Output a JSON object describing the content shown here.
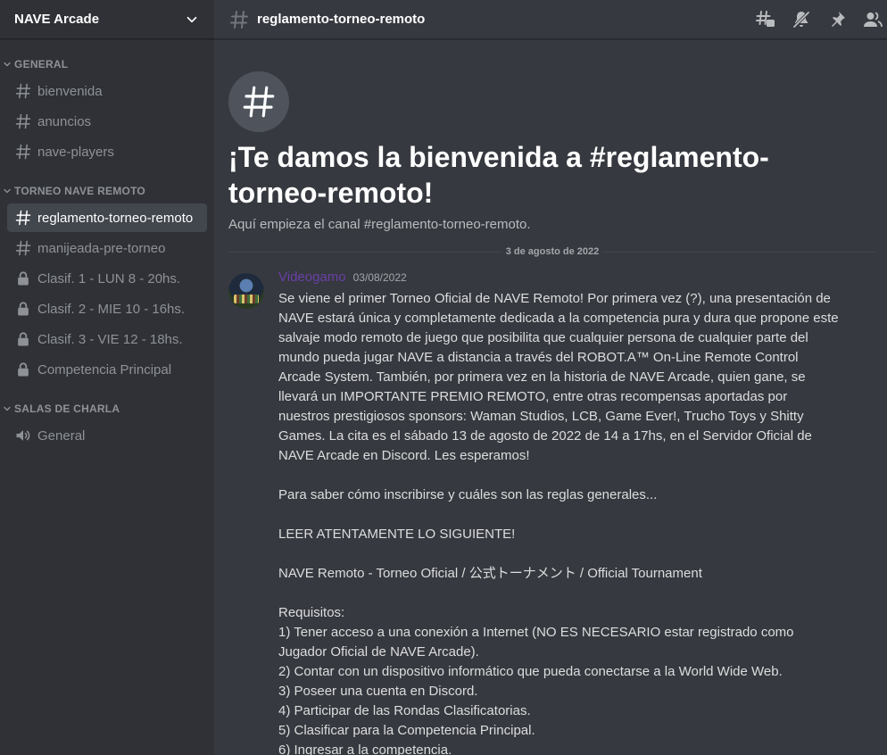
{
  "server": {
    "name": "NAVE Arcade"
  },
  "sidebar": {
    "categories": [
      {
        "label": "GENERAL",
        "channels": [
          {
            "label": "bienvenida",
            "icon": "hash-icon"
          },
          {
            "label": "anuncios",
            "icon": "hash-icon"
          },
          {
            "label": "nave-players",
            "icon": "hash-icon"
          }
        ]
      },
      {
        "label": "TORNEO NAVE REMOTO",
        "channels": [
          {
            "label": "reglamento-torneo-remoto",
            "icon": "hash-icon"
          },
          {
            "label": "manijeada-pre-torneo",
            "icon": "hash-icon"
          },
          {
            "label": "Clasif. 1 - LUN 8 - 20hs.",
            "icon": "lock-icon"
          },
          {
            "label": "Clasif. 2 - MIE 10 - 16hs.",
            "icon": "lock-icon"
          },
          {
            "label": "Clasif. 3 - VIE 12 - 18hs.",
            "icon": "lock-icon"
          },
          {
            "label": "Competencia Principal",
            "icon": "lock-icon"
          }
        ]
      },
      {
        "label": "SALAS DE CHARLA",
        "channels": [
          {
            "label": "General",
            "icon": "speaker-icon"
          }
        ]
      }
    ]
  },
  "header": {
    "channel_name": "reglamento-torneo-remoto",
    "tools": [
      "threads-icon",
      "mute-icon",
      "pin-icon",
      "members-icon"
    ]
  },
  "welcome": {
    "title": "¡Te damos la bienvenida a #reglamento-torneo-remoto!",
    "subtitle": "Aquí empieza el canal #reglamento-torneo-remoto."
  },
  "date_divider": "3 de agosto de 2022",
  "message": {
    "author": "Videogamo",
    "timestamp": "03/08/2022",
    "text": "Se viene el primer Torneo Oficial de NAVE Remoto! Por primera vez (?), una presentación de NAVE estará única y completamente dedicada a la competencia pura y dura que propone este salvaje modo remoto de juego que posibilita que cualquier persona de cualquier parte del mundo pueda jugar NAVE a distancia a través del ROBOT.A™ On-Line Remote Control Arcade System. También, por primera vez en la historia de NAVE Arcade, quien gane, se llevará un IMPORTANTE PREMIO REMOTO, entre otras recompensas aportadas por nuestros prestigiosos sponsors: Waman Studios, LCB, Game Ever!, Trucho Toys y Shitty Games. La cita es el sábado 13 de agosto de 2022 de 14 a 17hs, en el Servidor Oficial de NAVE Arcade en Discord. Les esperamos!\n\nPara saber cómo inscribirse y cuáles son las reglas generales...\n\nLEER ATENTAMENTE LO SIGUIENTE!\n\nNAVE Remoto - Torneo Oficial / 公式トーナメント / Official Tournament\n\nRequisitos:\n1) Tener acceso a una conexión a Internet (NO ES NECESARIO estar registrado como Jugador Oficial de NAVE Arcade).\n2) Contar con un dispositivo informático que pueda conectarse a la World Wide Web.\n3) Poseer una cuenta en Discord.\n4) Participar de las Rondas Clasificatorias.\n5) Clasificar para la Competencia Principal.\n6) Ingresar a la competencia."
  },
  "colors": {
    "sidebar_bg": "#2f3136",
    "main_bg": "#36393f",
    "active_channel_bg": "#42464d",
    "author_color": "#6a3fa8"
  }
}
